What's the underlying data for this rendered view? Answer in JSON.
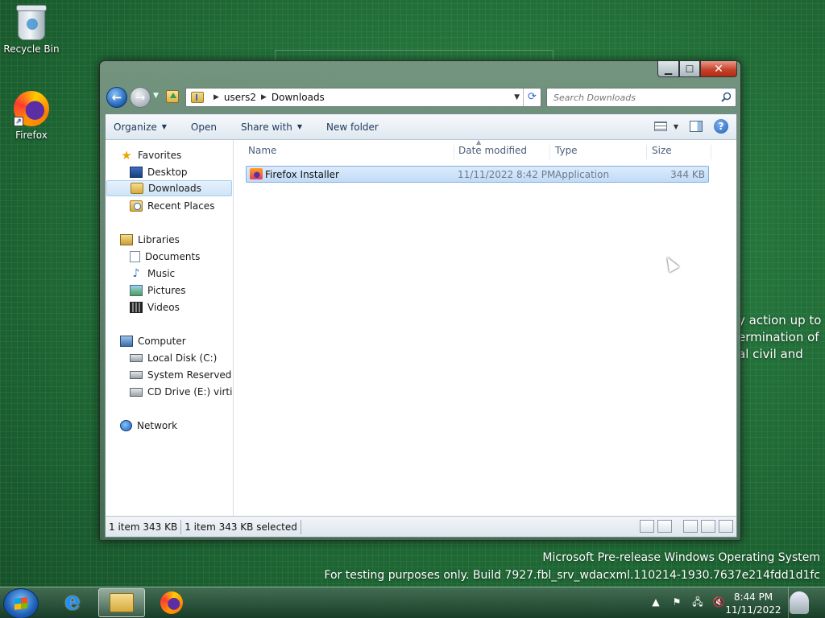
{
  "desktop": {
    "icons": [
      {
        "label": "Recycle Bin",
        "icon": "recycle-bin-icon"
      },
      {
        "label": "Firefox",
        "icon": "firefox-icon"
      }
    ],
    "watermark_partial": [
      "y action up to",
      "ermination of",
      "al civil and"
    ],
    "watermark": [
      "Microsoft Pre-release Windows Operating System",
      "For testing purposes only. Build 7927.fbl_srv_wdacxml.110214-1930.7637e214fdd1d1fc"
    ]
  },
  "window": {
    "address": {
      "crumbs": [
        "users2",
        "Downloads"
      ]
    },
    "search": {
      "placeholder": "Search Downloads"
    },
    "toolbar": {
      "organize": "Organize",
      "open": "Open",
      "share_with": "Share with",
      "new_folder": "New folder"
    },
    "nav": {
      "favorites": "Favorites",
      "desktop": "Desktop",
      "downloads": "Downloads",
      "recent_places": "Recent Places",
      "libraries": "Libraries",
      "documents": "Documents",
      "music": "Music",
      "pictures": "Pictures",
      "videos": "Videos",
      "computer": "Computer",
      "local_disk": "Local Disk (C:)",
      "system_reserved": "System Reserved (D:",
      "cd_drive": "CD Drive (E:) virtio-v",
      "network": "Network"
    },
    "columns": {
      "name": "Name",
      "date_modified": "Date modified",
      "type": "Type",
      "size": "Size"
    },
    "files": [
      {
        "name": "Firefox Installer",
        "date_modified": "11/11/2022 8:42 PM",
        "type": "Application",
        "size": "344 KB"
      }
    ],
    "status": {
      "items": "1 item 343 KB",
      "selected": "1 item 343 KB selected"
    }
  },
  "taskbar": {
    "clock_time": "8:44 PM",
    "clock_date": "11/11/2022"
  }
}
